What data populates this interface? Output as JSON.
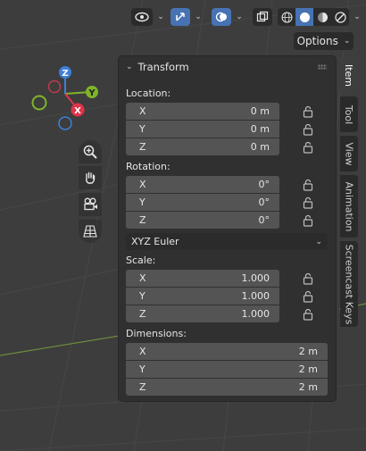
{
  "header": {
    "options_label": "Options"
  },
  "gizmo": {
    "z_label": "Z",
    "y_label": "Y",
    "x_label": "X"
  },
  "panel": {
    "title": "Transform",
    "location": {
      "label": "Location:",
      "rows": [
        {
          "axis": "X",
          "value": "0 m"
        },
        {
          "axis": "Y",
          "value": "0 m"
        },
        {
          "axis": "Z",
          "value": "0 m"
        }
      ]
    },
    "rotation": {
      "label": "Rotation:",
      "rows": [
        {
          "axis": "X",
          "value": "0°"
        },
        {
          "axis": "Y",
          "value": "0°"
        },
        {
          "axis": "Z",
          "value": "0°"
        }
      ],
      "mode": "XYZ Euler"
    },
    "scale": {
      "label": "Scale:",
      "rows": [
        {
          "axis": "X",
          "value": "1.000"
        },
        {
          "axis": "Y",
          "value": "1.000"
        },
        {
          "axis": "Z",
          "value": "1.000"
        }
      ]
    },
    "dimensions": {
      "label": "Dimensions:",
      "rows": [
        {
          "axis": "X",
          "value": "2 m"
        },
        {
          "axis": "Y",
          "value": "2 m"
        },
        {
          "axis": "Z",
          "value": "2 m"
        }
      ]
    }
  },
  "tabs": [
    {
      "label": "Item",
      "active": true
    },
    {
      "label": "Tool",
      "active": false
    },
    {
      "label": "View",
      "active": false
    },
    {
      "label": "Animation",
      "active": false
    },
    {
      "label": "Screencast Keys",
      "active": false
    }
  ],
  "colors": {
    "accent": "#4772b3",
    "axis_x": "#e0344a",
    "axis_y": "#7fb42a",
    "axis_z": "#3d7fd8"
  }
}
